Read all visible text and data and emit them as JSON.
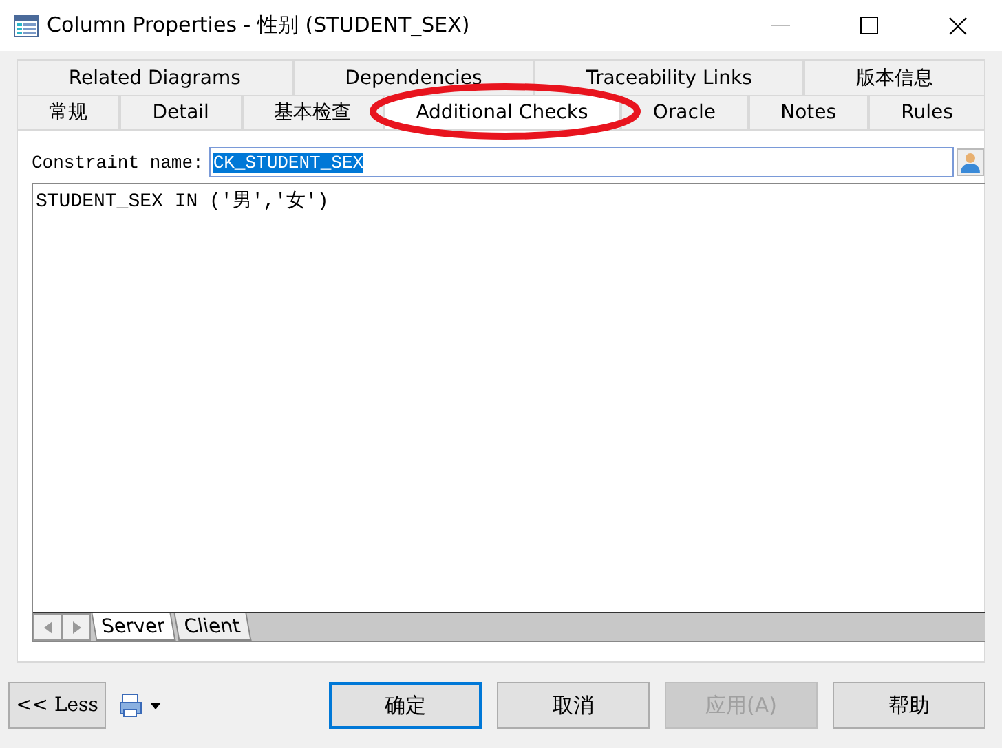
{
  "window": {
    "title": "Column Properties - 性别 (STUDENT_SEX)"
  },
  "tab_rows": [
    [
      {
        "label": "Related Diagrams",
        "selected": false
      },
      {
        "label": "Dependencies",
        "selected": false
      },
      {
        "label": "Traceability Links",
        "selected": false
      },
      {
        "label": "版本信息",
        "selected": false
      }
    ],
    [
      {
        "label": "常规",
        "selected": false
      },
      {
        "label": "Detail",
        "selected": false
      },
      {
        "label": "基本检查",
        "selected": false
      },
      {
        "label": "Additional Checks",
        "selected": true
      },
      {
        "label": "Oracle",
        "selected": false
      },
      {
        "label": "Notes",
        "selected": false
      },
      {
        "label": "Rules",
        "selected": false
      }
    ]
  ],
  "constraint": {
    "label": "Constraint name:",
    "value": "CK_STUDENT_SEX"
  },
  "expression": "STUDENT_SEX IN ('男','女')",
  "editor_tabs": [
    {
      "label": "Server",
      "selected": true
    },
    {
      "label": "Client",
      "selected": false
    }
  ],
  "footer": {
    "less_label": "<< Less"
  },
  "buttons": [
    {
      "label": "确定",
      "default": true,
      "disabled": false
    },
    {
      "label": "取消",
      "default": false,
      "disabled": false
    },
    {
      "label": "应用(A)",
      "default": false,
      "disabled": true
    },
    {
      "label": "帮助",
      "default": false,
      "disabled": false
    }
  ]
}
